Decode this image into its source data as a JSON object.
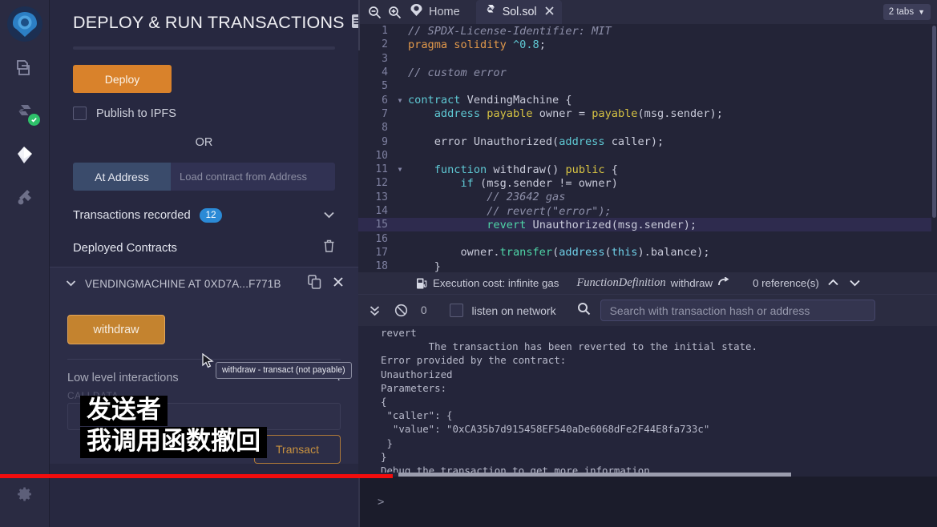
{
  "rail": {
    "logo": "remix-logo",
    "items": [
      {
        "name": "file-explorer",
        "icon": "files-icon"
      },
      {
        "name": "solidity-compiler",
        "icon": "solidity-icon",
        "badge": "check"
      },
      {
        "name": "deploy-and-run",
        "icon": "ethereum-icon",
        "active": true
      },
      {
        "name": "plugin-manager",
        "icon": "plug-icon"
      }
    ],
    "bottom": {
      "name": "settings",
      "icon": "gear-icon"
    }
  },
  "panel": {
    "title": "DEPLOY & RUN TRANSACTIONS",
    "header_icon": "document-icon",
    "deploy_label": "Deploy",
    "publish_ipfs_label": "Publish to IPFS",
    "or_label": "OR",
    "at_address_label": "At Address",
    "at_address_placeholder": "Load contract from Address",
    "transactions_recorded_label": "Transactions recorded",
    "transactions_recorded_count": "12",
    "deployed_contracts_label": "Deployed Contracts",
    "contract_title": "VENDINGMACHINE AT 0XD7A...F771B",
    "withdraw_label": "withdraw",
    "tooltip_text": "withdraw - transact (not payable)",
    "low_level_label": "Low level interactions",
    "calldata_label": "CALLDATA",
    "calldata_value": "",
    "transact_label": "Transact"
  },
  "overlay": {
    "line1": "发送者",
    "line2": "我调用函数撤回"
  },
  "tabbar": {
    "zoom_out_icon": "zoom-out-icon",
    "zoom_in_icon": "zoom-in-icon",
    "home_icon": "remix-home-icon",
    "home_label": "Home",
    "sol_icon": "solidity-file-icon",
    "sol_label": "Sol.sol",
    "close_icon": "close-icon",
    "tabs_count_label": "2 tabs"
  },
  "editor": {
    "highlight_line": 15,
    "lines": [
      {
        "n": "1",
        "fold": "",
        "tokens": [
          {
            "t": "// SPDX-License-Identifier: MIT",
            "c": "c-com"
          }
        ]
      },
      {
        "n": "2",
        "fold": "",
        "tokens": [
          {
            "t": "pragma",
            "c": "c-kw"
          },
          {
            "t": " ",
            "c": "c-plain"
          },
          {
            "t": "solidity",
            "c": "c-kw"
          },
          {
            "t": " ",
            "c": "c-plain"
          },
          {
            "t": "^0.8",
            "c": "c-num"
          },
          {
            "t": ";",
            "c": "c-plain"
          }
        ]
      },
      {
        "n": "3",
        "fold": "",
        "tokens": []
      },
      {
        "n": "4",
        "fold": "",
        "tokens": [
          {
            "t": "// custom error",
            "c": "c-com"
          }
        ]
      },
      {
        "n": "5",
        "fold": "",
        "tokens": []
      },
      {
        "n": "6",
        "fold": "▼",
        "tokens": [
          {
            "t": "contract",
            "c": "c-kw2"
          },
          {
            "t": " VendingMachine {",
            "c": "c-plain"
          }
        ]
      },
      {
        "n": "7",
        "fold": "",
        "tokens": [
          {
            "t": "    ",
            "c": "c-plain"
          },
          {
            "t": "address",
            "c": "c-kw2"
          },
          {
            "t": " ",
            "c": "c-plain"
          },
          {
            "t": "payable",
            "c": "c-type"
          },
          {
            "t": " owner = ",
            "c": "c-plain"
          },
          {
            "t": "payable",
            "c": "c-type"
          },
          {
            "t": "(msg.sender);",
            "c": "c-plain"
          }
        ]
      },
      {
        "n": "8",
        "fold": "",
        "tokens": []
      },
      {
        "n": "9",
        "fold": "",
        "tokens": [
          {
            "t": "    error Unauthorized(",
            "c": "c-plain"
          },
          {
            "t": "address",
            "c": "c-kw2"
          },
          {
            "t": " caller);",
            "c": "c-plain"
          }
        ]
      },
      {
        "n": "10",
        "fold": "",
        "tokens": []
      },
      {
        "n": "11",
        "fold": "▼",
        "tokens": [
          {
            "t": "    ",
            "c": "c-plain"
          },
          {
            "t": "function",
            "c": "c-kw2"
          },
          {
            "t": " withdraw() ",
            "c": "c-plain"
          },
          {
            "t": "public",
            "c": "c-type"
          },
          {
            "t": " {",
            "c": "c-plain"
          }
        ]
      },
      {
        "n": "12",
        "fold": "",
        "tokens": [
          {
            "t": "        ",
            "c": "c-plain"
          },
          {
            "t": "if",
            "c": "c-kw2"
          },
          {
            "t": " (msg.sender != owner)",
            "c": "c-plain"
          }
        ]
      },
      {
        "n": "13",
        "fold": "",
        "tokens": [
          {
            "t": "            // 23642 gas",
            "c": "c-com"
          }
        ]
      },
      {
        "n": "14",
        "fold": "",
        "tokens": [
          {
            "t": "            // revert(\"error\");",
            "c": "c-com"
          }
        ]
      },
      {
        "n": "15",
        "fold": "",
        "tokens": [
          {
            "t": "            ",
            "c": "c-plain"
          },
          {
            "t": "revert",
            "c": "c-green"
          },
          {
            "t": " Unauthorized(msg.sender);",
            "c": "c-plain"
          }
        ]
      },
      {
        "n": "16",
        "fold": "",
        "tokens": []
      },
      {
        "n": "17",
        "fold": "",
        "tokens": [
          {
            "t": "        owner.",
            "c": "c-plain"
          },
          {
            "t": "transfer",
            "c": "c-green"
          },
          {
            "t": "(",
            "c": "c-plain"
          },
          {
            "t": "address",
            "c": "c-addr"
          },
          {
            "t": "(",
            "c": "c-plain"
          },
          {
            "t": "this",
            "c": "c-addr"
          },
          {
            "t": ").balance);",
            "c": "c-plain"
          }
        ]
      },
      {
        "n": "18",
        "fold": "",
        "tokens": [
          {
            "t": "    }",
            "c": "c-plain"
          }
        ]
      }
    ]
  },
  "codelens": {
    "gas_icon": "gas-pump-icon",
    "execution_cost": "Execution cost: infinite gas",
    "function_definition_label": "FunctionDefinition",
    "function_name": "withdraw",
    "goto_icon": "arrow-forward-icon",
    "references": "0 reference(s)",
    "up_icon": "chevron-up-icon",
    "down_icon": "chevron-down-icon"
  },
  "terminal_bar": {
    "collapse_icon": "double-chevron-down-icon",
    "clear_icon": "ban-icon",
    "pending_count": "0",
    "listen_label": "listen on network",
    "search_icon": "search-icon",
    "search_placeholder": "Search with transaction hash or address",
    "search_value": ""
  },
  "terminal_log": {
    "lines": [
      "revert",
      "        The transaction has been reverted to the initial state.",
      "Error provided by the contract:",
      "Unauthorized",
      "Parameters:",
      "{",
      " \"caller\": {",
      "  \"value\": \"0xCA35b7d915458EF540aDe6068dFe2F44E8fa733c\"",
      " }",
      "}",
      "Debug the transaction to get more information."
    ],
    "prompt": ">"
  },
  "colors": {
    "accent_orange": "#d9822b",
    "panel_bg": "#272840",
    "rail_bg": "#2a2b42",
    "editor_bg": "#232437",
    "badge_blue": "#2b8ad6",
    "check_green": "#2ec16a",
    "red_line": "#f20d0d"
  }
}
